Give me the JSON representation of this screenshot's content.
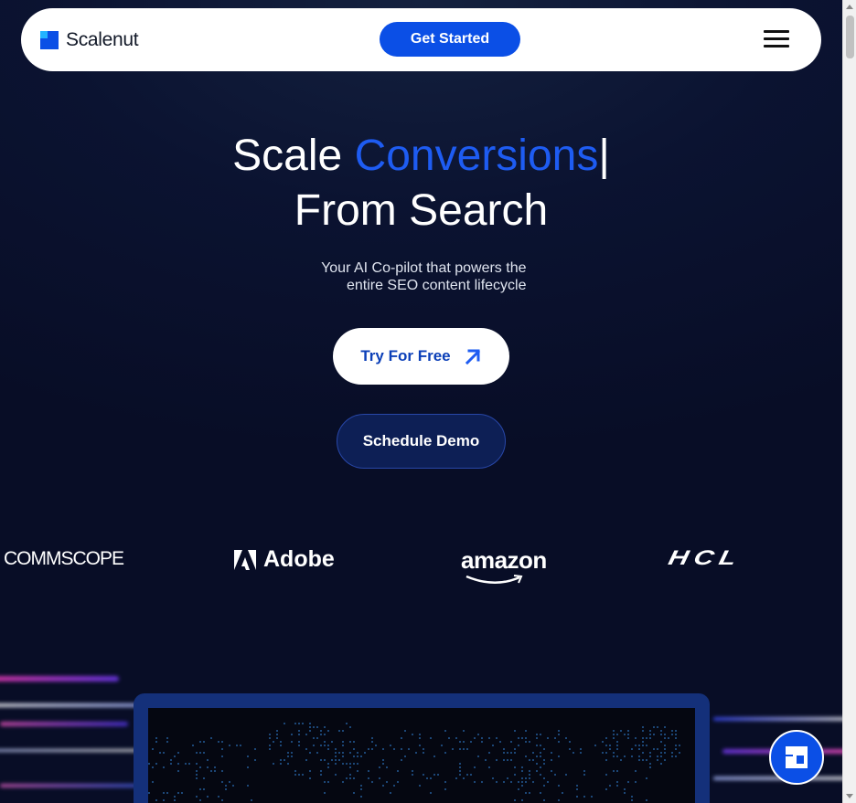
{
  "header": {
    "brand": "Scalenut",
    "cta_label": "Get Started",
    "menu_icon": "hamburger-icon"
  },
  "hero": {
    "title_prefix": "Scale ",
    "title_accent": "Conversions",
    "title_cursor": "|",
    "title_line2": "From Search",
    "subtitle_line1": "Your AI Co-pilot that powers the",
    "subtitle_line2": "entire SEO content lifecycle",
    "primary_cta": "Try For Free",
    "primary_cta_icon": "arrow-up-right-icon",
    "secondary_cta": "Schedule Demo"
  },
  "clients": {
    "logos": [
      "COMMSCOPE",
      "Adobe",
      "amazon",
      "HCL"
    ]
  },
  "chat_widget": {
    "icon": "scalenut-chat-icon"
  },
  "colors": {
    "brand_blue": "#0b4fe6",
    "accent_text": "#1e5cf2",
    "background": "#0b1331"
  }
}
